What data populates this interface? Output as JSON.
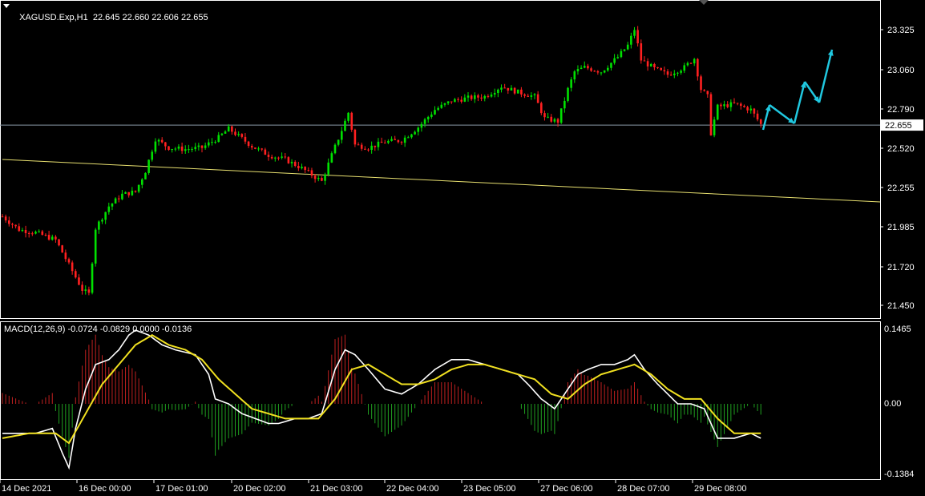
{
  "chart_data": {
    "type": "candlestick",
    "symbol_header": "XAGUSD.Exp,H1",
    "ohlc_header": "22.645 22.660 22.606 22.655",
    "current_price": "22.655",
    "price_axis": {
      "range": [
        21.33,
        23.51
      ],
      "ticks": [
        "23.325",
        "23.060",
        "22.790",
        "22.520",
        "22.255",
        "21.985",
        "21.720",
        "21.450"
      ]
    },
    "time_axis_labels": [
      "14 Dec 2021",
      "16 Dec 00:00",
      "17 Dec 01:00",
      "20 Dec 02:00",
      "21 Dec 03:00",
      "22 Dec 04:00",
      "23 Dec 05:00",
      "27 Dec 06:00",
      "28 Dec 07:00",
      "29 Dec 08:00"
    ],
    "price_path": [
      [
        0,
        22.03
      ],
      [
        5,
        21.94
      ],
      [
        10,
        21.92
      ],
      [
        16,
        21.87
      ],
      [
        20,
        21.7
      ],
      [
        24,
        21.53
      ],
      [
        26,
        21.5
      ],
      [
        28,
        21.95
      ],
      [
        32,
        22.1
      ],
      [
        36,
        22.18
      ],
      [
        40,
        22.2
      ],
      [
        43,
        22.34
      ],
      [
        46,
        22.56
      ],
      [
        50,
        22.5
      ],
      [
        55,
        22.49
      ],
      [
        60,
        22.5
      ],
      [
        65,
        22.57
      ],
      [
        68,
        22.63
      ],
      [
        71,
        22.58
      ],
      [
        75,
        22.51
      ],
      [
        80,
        22.45
      ],
      [
        85,
        22.42
      ],
      [
        90,
        22.36
      ],
      [
        94,
        22.3
      ],
      [
        96,
        22.27
      ],
      [
        99,
        22.45
      ],
      [
        102,
        22.62
      ],
      [
        104,
        22.74
      ],
      [
        106,
        22.52
      ],
      [
        110,
        22.5
      ],
      [
        115,
        22.54
      ],
      [
        120,
        22.55
      ],
      [
        125,
        22.64
      ],
      [
        130,
        22.76
      ],
      [
        135,
        22.82
      ],
      [
        140,
        22.84
      ],
      [
        145,
        22.85
      ],
      [
        150,
        22.92
      ],
      [
        155,
        22.88
      ],
      [
        160,
        22.85
      ],
      [
        163,
        22.7
      ],
      [
        167,
        22.68
      ],
      [
        170,
        22.9
      ],
      [
        172,
        23.02
      ],
      [
        175,
        23.05
      ],
      [
        180,
        23.02
      ],
      [
        185,
        23.12
      ],
      [
        188,
        23.2
      ],
      [
        190,
        23.31
      ],
      [
        192,
        23.1
      ],
      [
        196,
        23.04
      ],
      [
        200,
        23.0
      ],
      [
        205,
        23.05
      ],
      [
        208,
        23.11
      ],
      [
        210,
        22.9
      ],
      [
        212,
        22.85
      ],
      [
        213,
        22.6
      ],
      [
        215,
        22.78
      ],
      [
        220,
        22.8
      ],
      [
        225,
        22.76
      ],
      [
        228,
        22.66
      ]
    ],
    "forecast_arrows": [
      [
        [
          952,
          162
        ],
        [
          960,
          131
        ]
      ],
      [
        [
          960,
          131
        ],
        [
          991,
          154
        ]
      ],
      [
        [
          991,
          154
        ],
        [
          1004,
          102
        ]
      ],
      [
        [
          1004,
          102
        ],
        [
          1022,
          128
        ]
      ],
      [
        [
          1022,
          128
        ],
        [
          1038,
          62
        ]
      ]
    ],
    "trendline": {
      "from": [
        0,
        22.42
      ],
      "to": [
        264,
        22.13
      ]
    },
    "macd": {
      "header": "MACD(12,26,9) -0.0724 -0.0829 0.0000 -0.0136",
      "range": [
        -0.155,
        0.168
      ],
      "ticks": [
        "0.1465",
        "0.00",
        "-0.1384"
      ],
      "macd_path": [
        [
          0,
          -0.06
        ],
        [
          10,
          -0.06
        ],
        [
          15,
          -0.05
        ],
        [
          18,
          -0.1
        ],
        [
          20,
          -0.13
        ],
        [
          22,
          -0.05
        ],
        [
          25,
          0.03
        ],
        [
          28,
          0.08
        ],
        [
          32,
          0.09
        ],
        [
          35,
          0.11
        ],
        [
          38,
          0.14
        ],
        [
          40,
          0.15
        ],
        [
          44,
          0.14
        ],
        [
          48,
          0.12
        ],
        [
          52,
          0.11
        ],
        [
          58,
          0.1
        ],
        [
          62,
          0.06
        ],
        [
          64,
          0.01
        ],
        [
          68,
          0.0
        ],
        [
          72,
          -0.02
        ],
        [
          76,
          -0.03
        ],
        [
          80,
          -0.04
        ],
        [
          83,
          -0.04
        ],
        [
          88,
          -0.03
        ],
        [
          92,
          -0.03
        ],
        [
          96,
          -0.02
        ],
        [
          100,
          0.07
        ],
        [
          103,
          0.11
        ],
        [
          106,
          0.1
        ],
        [
          110,
          0.07
        ],
        [
          115,
          0.03
        ],
        [
          120,
          0.02
        ],
        [
          125,
          0.04
        ],
        [
          130,
          0.07
        ],
        [
          135,
          0.09
        ],
        [
          140,
          0.09
        ],
        [
          145,
          0.08
        ],
        [
          150,
          0.07
        ],
        [
          155,
          0.06
        ],
        [
          158,
          0.04
        ],
        [
          162,
          0.01
        ],
        [
          166,
          -0.01
        ],
        [
          170,
          0.03
        ],
        [
          173,
          0.06
        ],
        [
          176,
          0.07
        ],
        [
          180,
          0.08
        ],
        [
          184,
          0.08
        ],
        [
          188,
          0.09
        ],
        [
          190,
          0.1
        ],
        [
          193,
          0.07
        ],
        [
          197,
          0.04
        ],
        [
          200,
          0.02
        ],
        [
          203,
          0.0
        ],
        [
          207,
          0.0
        ],
        [
          211,
          -0.01
        ],
        [
          213,
          -0.04
        ],
        [
          215,
          -0.07
        ],
        [
          220,
          -0.07
        ],
        [
          225,
          -0.06
        ],
        [
          228,
          -0.07
        ]
      ],
      "signal_path": [
        [
          0,
          -0.07
        ],
        [
          8,
          -0.06
        ],
        [
          16,
          -0.06
        ],
        [
          20,
          -0.08
        ],
        [
          25,
          -0.02
        ],
        [
          30,
          0.04
        ],
        [
          35,
          0.08
        ],
        [
          40,
          0.12
        ],
        [
          45,
          0.14
        ],
        [
          50,
          0.12
        ],
        [
          55,
          0.11
        ],
        [
          60,
          0.09
        ],
        [
          65,
          0.05
        ],
        [
          70,
          0.02
        ],
        [
          75,
          -0.01
        ],
        [
          80,
          -0.02
        ],
        [
          85,
          -0.03
        ],
        [
          90,
          -0.03
        ],
        [
          95,
          -0.03
        ],
        [
          100,
          0.01
        ],
        [
          105,
          0.07
        ],
        [
          110,
          0.08
        ],
        [
          115,
          0.06
        ],
        [
          120,
          0.04
        ],
        [
          125,
          0.04
        ],
        [
          130,
          0.05
        ],
        [
          135,
          0.07
        ],
        [
          140,
          0.08
        ],
        [
          145,
          0.08
        ],
        [
          150,
          0.07
        ],
        [
          155,
          0.06
        ],
        [
          160,
          0.05
        ],
        [
          165,
          0.02
        ],
        [
          170,
          0.01
        ],
        [
          175,
          0.04
        ],
        [
          180,
          0.06
        ],
        [
          185,
          0.07
        ],
        [
          190,
          0.08
        ],
        [
          195,
          0.06
        ],
        [
          200,
          0.03
        ],
        [
          205,
          0.01
        ],
        [
          210,
          0.01
        ],
        [
          215,
          -0.03
        ],
        [
          220,
          -0.06
        ],
        [
          225,
          -0.06
        ],
        [
          228,
          -0.06
        ]
      ]
    }
  }
}
